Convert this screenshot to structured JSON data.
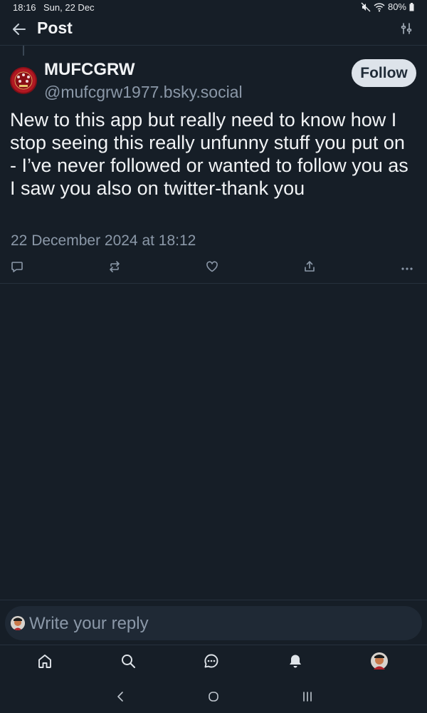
{
  "status_bar": {
    "time": "18:16",
    "date": "Sun, 22 Dec",
    "battery": "80%"
  },
  "header": {
    "title": "Post"
  },
  "post": {
    "author_name": "MUFCGRW",
    "author_handle": "@mufcgrw1977.bsky.social",
    "follow_label": "Follow",
    "text": "New to this app but really need to know how I stop seeing this really unfunny stuff you put on - I’ve never followed or wanted to follow you as I saw you also on twitter-thank you",
    "timestamp": "22 December 2024 at 18:12"
  },
  "reply": {
    "placeholder": "Write your reply"
  },
  "icons": {
    "back": "arrow-left-icon",
    "settings": "sliders-icon",
    "reply": "comment-icon",
    "repost": "repost-icon",
    "like": "heart-icon",
    "share": "share-icon",
    "more": "more-dots-icon",
    "nav": [
      "home-icon",
      "search-icon",
      "chat-icon",
      "bell-icon",
      "profile-avatar"
    ]
  },
  "colors": {
    "background": "#161e27",
    "text": "#f1f3f5",
    "muted": "#8b98a8",
    "follow_bg": "#dde3ea",
    "avatar_red": "#c3202b"
  }
}
